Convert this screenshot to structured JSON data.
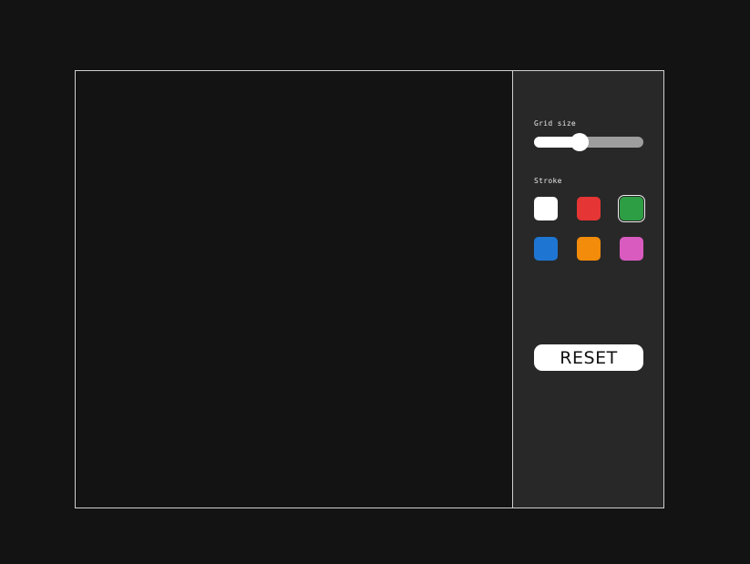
{
  "controls": {
    "grid_size_label": "Grid size",
    "grid_size_value": 0.42,
    "stroke_label": "Stroke",
    "stroke_colors": [
      {
        "name": "white",
        "hex": "#ffffff"
      },
      {
        "name": "red",
        "hex": "#e53535"
      },
      {
        "name": "green",
        "hex": "#2e9e45"
      },
      {
        "name": "blue",
        "hex": "#1f76d2"
      },
      {
        "name": "orange",
        "hex": "#f28c0a"
      },
      {
        "name": "pink",
        "hex": "#d95bc0"
      }
    ],
    "selected_stroke": "green",
    "reset_label": "RESET"
  }
}
